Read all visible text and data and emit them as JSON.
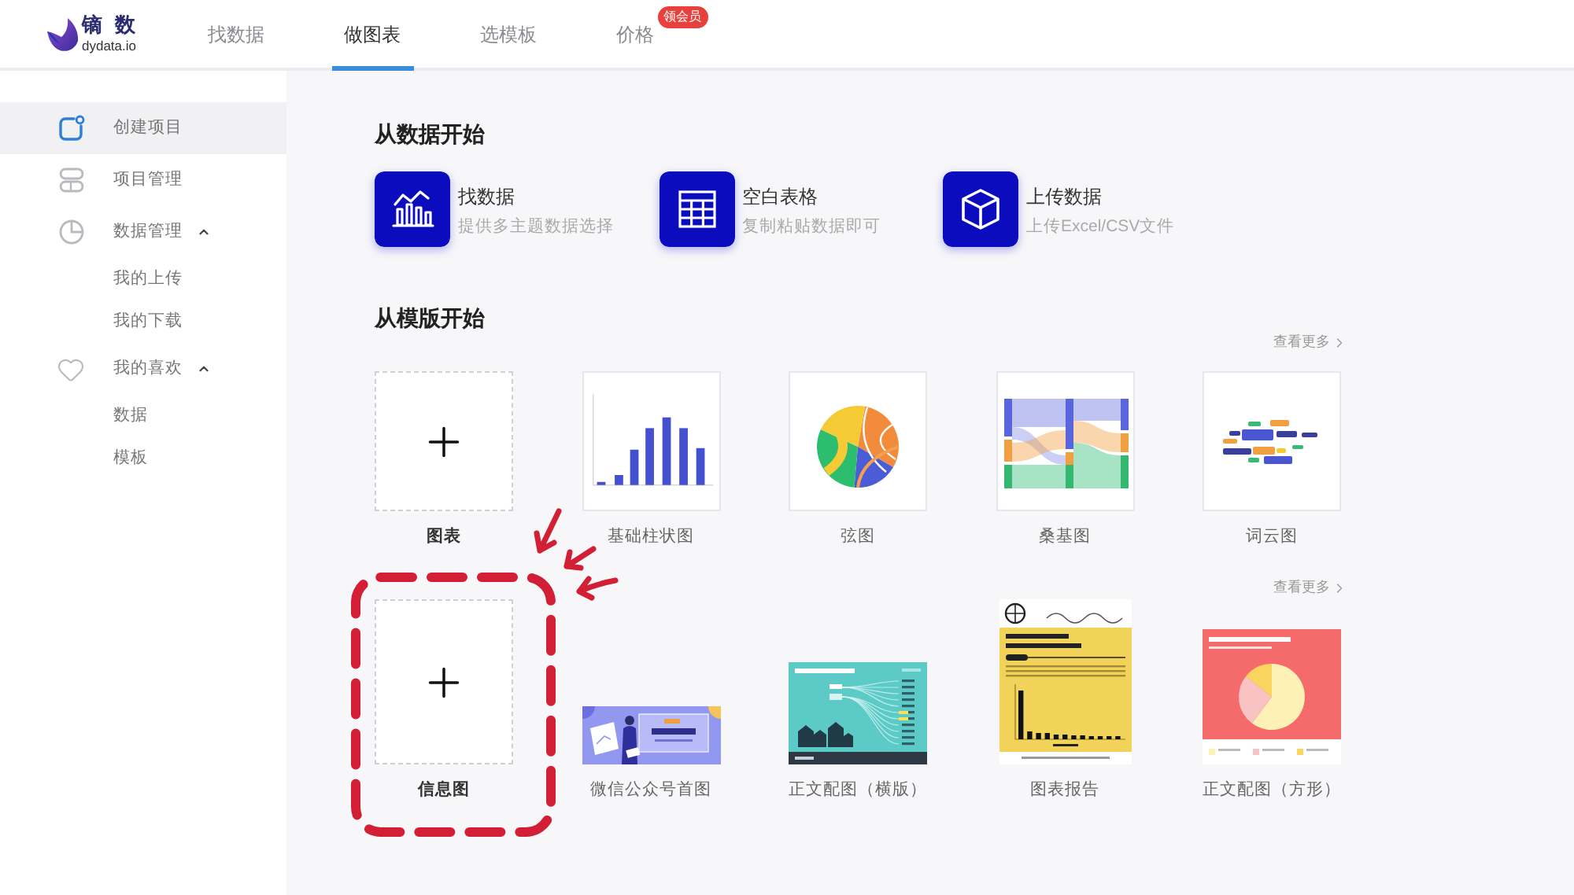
{
  "header": {
    "logo": {
      "name": "镝数",
      "domain": "dydata.io"
    },
    "nav": [
      {
        "label": "找数据",
        "selected": false
      },
      {
        "label": "做图表",
        "selected": true
      },
      {
        "label": "选模板",
        "selected": false
      },
      {
        "label": "价格",
        "selected": false,
        "badge": "领会员"
      }
    ]
  },
  "sidebar": {
    "items": [
      {
        "kind": "create",
        "label": "创建项目",
        "selected": true
      },
      {
        "kind": "projects",
        "label": "项目管理",
        "selected": false
      },
      {
        "kind": "data",
        "label": "数据管理",
        "selected": false,
        "expanded": true,
        "children": [
          {
            "label": "我的上传",
            "selected": false
          },
          {
            "label": "我的下载",
            "selected": false
          }
        ]
      },
      {
        "kind": "favorites",
        "label": "我的喜欢",
        "selected": false,
        "expanded": true,
        "children": [
          {
            "label": "数据",
            "selected": false
          },
          {
            "label": "模板",
            "selected": false
          }
        ]
      }
    ]
  },
  "data_section": {
    "title": "从数据开始",
    "actions": [
      {
        "kind": "find",
        "title": "找数据",
        "subtitle": "提供多主题数据选择"
      },
      {
        "kind": "table",
        "title": "空白表格",
        "subtitle": "复制粘贴数据即可"
      },
      {
        "kind": "upload",
        "title": "上传数据",
        "subtitle": "上传Excel/CSV文件"
      }
    ]
  },
  "template_section": {
    "title": "从模版开始",
    "groups": [
      {
        "more": "查看更多",
        "items": [
          {
            "kind": "blank",
            "label": "图表",
            "highlighted": false
          },
          {
            "kind": "bar",
            "label": "基础柱状图",
            "highlighted": false
          },
          {
            "kind": "chord",
            "label": "弦图",
            "highlighted": false
          },
          {
            "kind": "sankey",
            "label": "桑基图",
            "highlighted": false
          },
          {
            "kind": "wordcloud",
            "label": "词云图",
            "highlighted": false
          }
        ]
      },
      {
        "more": "查看更多",
        "items": [
          {
            "kind": "blank",
            "label": "信息图",
            "highlighted": true
          },
          {
            "kind": "cover",
            "label": "微信公众号首图",
            "highlighted": false
          },
          {
            "kind": "landscape",
            "label": "正文配图（横版）",
            "highlighted": false
          },
          {
            "kind": "report",
            "label": "图表报告",
            "highlighted": false
          },
          {
            "kind": "square",
            "label": "正文配图（方形）",
            "highlighted": false
          }
        ]
      }
    ]
  }
}
